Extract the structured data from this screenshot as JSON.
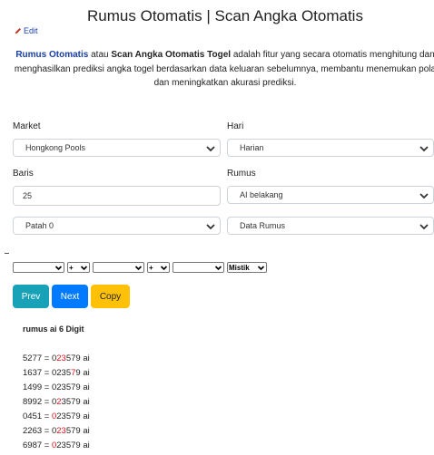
{
  "page_title": "Rumus Otomatis | Scan Angka Otomatis",
  "edit_label": "Edit",
  "description": {
    "link": "Rumus Otomatis",
    "mid1": " atau ",
    "bold": "Scan Angka Otomatis Togel",
    "rest1": " adalah fitur yang secara otomatis menghitung dan",
    "line2": "menghasilkan prediksi angka togel berdasarkan data keluaran sebelumnya, membantu menemukan pola",
    "line3": "dan meningkatkan akurasi prediksi."
  },
  "form": {
    "market_label": "Market",
    "market_value": "Hongkong Pools",
    "hari_label": "Hari",
    "hari_value": "Harian",
    "baris_label": "Baris",
    "baris_value": "25",
    "rumus_label": "Rumus",
    "rumus_value": "AI belakang",
    "patah_value": "Patah 0",
    "data_value": "Data Rumus"
  },
  "toolbar": {
    "op1": "+",
    "op2": "+",
    "mode": "Mistik"
  },
  "buttons": {
    "prev": "Prev",
    "next": "Next",
    "copy": "Copy"
  },
  "results": {
    "title": "rumus ai 6 Digit",
    "suffix": "ai",
    "rows": [
      {
        "num": "5277",
        "pre": "0",
        "red": "23",
        "mid": "5",
        "red2": "",
        "post": "79"
      },
      {
        "num": "1637",
        "pre": "0",
        "red": "",
        "mid": "235",
        "red2": "7",
        "post": "9"
      },
      {
        "num": "1499",
        "pre": "0",
        "red": "",
        "mid": "23579",
        "red2": "",
        "post": ""
      },
      {
        "num": "8992",
        "pre": "0",
        "red": "2",
        "mid": "3579",
        "red2": "",
        "post": ""
      },
      {
        "num": "0451",
        "pre": "",
        "red": "0",
        "mid": "23579",
        "red2": "",
        "post": ""
      },
      {
        "num": "2263",
        "pre": "0",
        "red": "23",
        "mid": "579",
        "red2": "",
        "post": ""
      },
      {
        "num": "6987",
        "pre": "",
        "red": "0",
        "mid": "23579",
        "red2": "",
        "post": ""
      }
    ]
  },
  "colors": {
    "link": "#1a3fa8",
    "prev": "#17a2b8",
    "next": "#007bff",
    "copy": "#ffc107",
    "highlight": "#e0121d"
  },
  "icons": {
    "edit": "pencil-icon",
    "dropdown": "chevron-down-icon"
  }
}
